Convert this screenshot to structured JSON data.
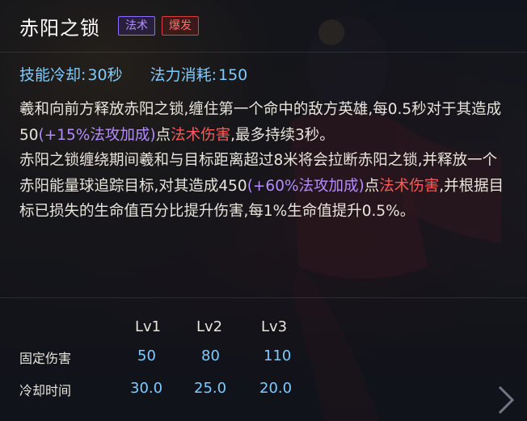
{
  "skill": {
    "name": "赤阳之锁",
    "tags": [
      {
        "label": "法术",
        "kind": "magic"
      },
      {
        "label": "爆发",
        "kind": "burst"
      }
    ],
    "cooldown_label": "技能冷却:",
    "cooldown_value": "30秒",
    "cost_label": "法力消耗:",
    "cost_value": "150"
  },
  "description": {
    "p1_a": "羲和向前方释放赤阳之锁,缠住第一个命中的敌方英雄,每0.5秒对于其造成50",
    "p1_b": "(+15%法攻加成)",
    "p1_c": "点",
    "p1_d": "法术伤害",
    "p1_e": ",最多持续3秒。",
    "p2_a": "赤阳之锁缠绕期间羲和与目标距离超过8米将会拉断赤阳之锁,并释放一个赤阳能量球追踪目标,对其造成450",
    "p2_b": "(+60%法攻加成)",
    "p2_c": "点",
    "p2_d": "法术伤害",
    "p2_e": ",并根据目标已损失的生命值百分比提升伤害,每1%生命值提升0.5%。"
  },
  "levels": {
    "headers": [
      "Lv1",
      "Lv2",
      "Lv3"
    ],
    "rows": [
      {
        "label": "固定伤害",
        "values": [
          "50",
          "80",
          "110"
        ]
      },
      {
        "label": "冷却时间",
        "values": [
          "30.0",
          "25.0",
          "20.0"
        ]
      }
    ]
  },
  "colors": {
    "accent_blue": "#7ecbff",
    "magic_purple": "#b58cff",
    "damage_red": "#ff5a5a"
  },
  "icons": [
    "next-arrow-icon"
  ]
}
